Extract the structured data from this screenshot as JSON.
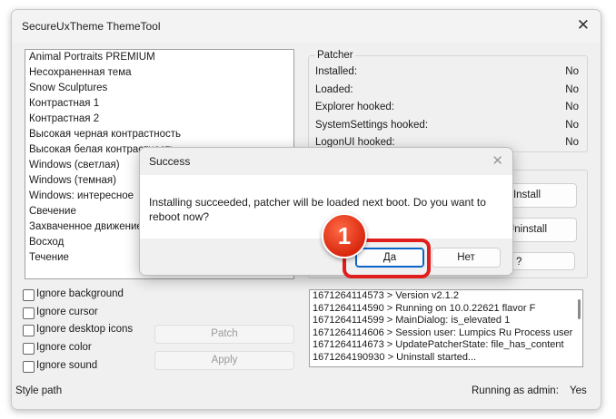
{
  "window": {
    "title": "SecureUxTheme ThemeTool",
    "close_glyph": "✕"
  },
  "themes": [
    "Animal Portraits PREMIUM",
    "Несохраненная тема",
    "Snow Sculptures",
    "Контрастная 1",
    "Контрастная 2",
    "Высокая черная контрастность",
    "Высокая белая контрастность",
    "Windows (светлая)",
    "Windows (темная)",
    "Windows: интересное",
    "Свечение",
    "Захваченное движение",
    "Восход",
    "Течение"
  ],
  "patcher": {
    "title": "Patcher",
    "rows": [
      {
        "label": "Installed:",
        "value": "No"
      },
      {
        "label": "Loaded:",
        "value": "No"
      },
      {
        "label": "Explorer hooked:",
        "value": "No"
      },
      {
        "label": "SystemSettings hooked:",
        "value": "No"
      },
      {
        "label": "LogonUI hooked:",
        "value": "No"
      }
    ]
  },
  "buttons": {
    "install": "Install",
    "uninstall": "Uninstall",
    "hidden_partial": "?",
    "patch": "Patch",
    "apply": "Apply"
  },
  "options": [
    "Ignore background",
    "Ignore cursor",
    "Ignore desktop icons",
    "Ignore color",
    "Ignore sound"
  ],
  "log": [
    "1671264114573 > Version v2.1.2",
    "1671264114590 > Running on 10.0.22621 flavor F",
    "1671264114599 > MainDialog: is_elevated 1",
    "1671264114606 > Session user: Lumpics Ru Process user",
    "1671264114673 > UpdatePatcherState: file_has_content",
    "1671264190930 > Uninstall started..."
  ],
  "status": {
    "style_path_label": "Style path",
    "admin_label": "Running as admin:",
    "admin_value": "Yes"
  },
  "dialog": {
    "title": "Success",
    "message": "Installing succeeded, patcher will be loaded next boot. Do you want to reboot now?",
    "yes": "Да",
    "no": "Нет",
    "close_glyph": "✕"
  },
  "annotation": {
    "step": "1",
    "accent": "#e01e1e"
  }
}
